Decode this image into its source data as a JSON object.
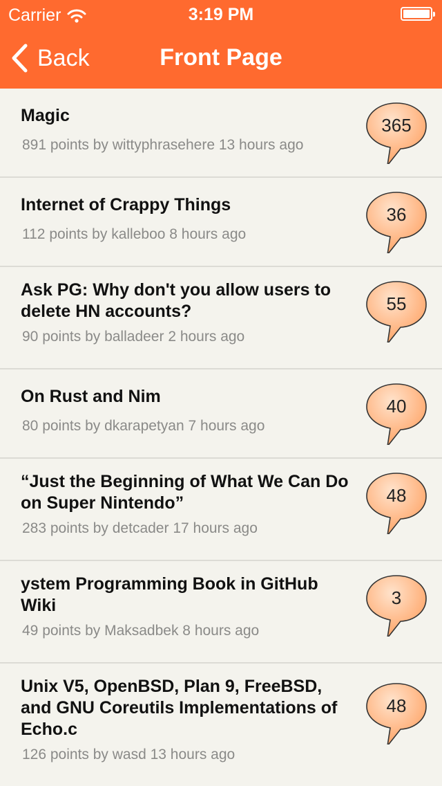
{
  "status": {
    "carrier": "Carrier",
    "time": "3:19 PM"
  },
  "nav": {
    "back_label": "Back",
    "title": "Front Page"
  },
  "colors": {
    "header": "#ff6a2f",
    "background": "#f4f3ed",
    "bubble_fill_top": "#ffe3cc",
    "bubble_fill_bottom": "#ffa060"
  },
  "stories": [
    {
      "title": "Magic",
      "meta": "891 points by wittyphrasehere 13 hours ago",
      "comments": "365"
    },
    {
      "title": "Internet of Crappy Things",
      "meta": "112 points by kalleboo 8 hours ago",
      "comments": "36"
    },
    {
      "title": "Ask PG: Why don't you allow users to delete HN accounts?",
      "meta": "90 points by balladeer 2 hours ago",
      "comments": "55"
    },
    {
      "title": "On Rust and Nim",
      "meta": "80 points by dkarapetyan 7 hours ago",
      "comments": "40"
    },
    {
      "title": "“Just the Beginning of What We Can Do on Super Nintendo”",
      "meta": "283 points by detcader 17 hours ago",
      "comments": "48"
    },
    {
      "title": "ystem Programming Book in GitHub Wiki",
      "meta": "49 points by Maksadbek 8 hours ago",
      "comments": "3"
    },
    {
      "title": "Unix V5, OpenBSD, Plan 9, FreeBSD, and GNU Coreutils Implementations of Echo.c",
      "meta": "126 points by wasd 13 hours ago",
      "comments": "48"
    }
  ]
}
